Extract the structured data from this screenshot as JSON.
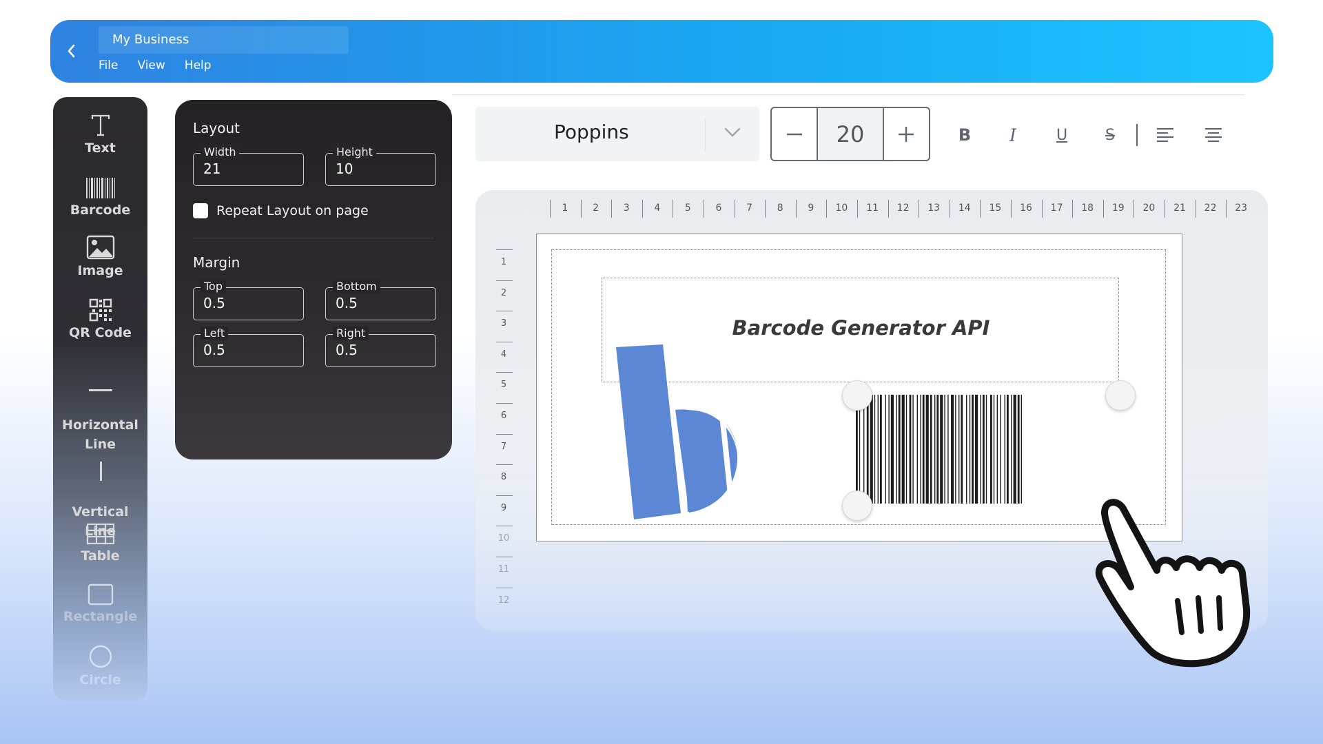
{
  "header": {
    "document_title": "My Business",
    "menu": [
      "File",
      "View",
      "Help"
    ]
  },
  "tools": [
    {
      "label": "Text",
      "icon": "text-icon"
    },
    {
      "label": "Barcode",
      "icon": "barcode-icon"
    },
    {
      "label": "Image",
      "icon": "image-icon"
    },
    {
      "label": "QR Code",
      "icon": "qr-code-icon"
    },
    {
      "label": "Horizontal\nLine",
      "icon": "horizontal-line-icon"
    },
    {
      "label": "Vertical\nLine",
      "icon": "vertical-line-icon"
    },
    {
      "label": "Table",
      "icon": "table-icon"
    },
    {
      "label": "Rectangle",
      "icon": "rectangle-icon"
    },
    {
      "label": "Circle",
      "icon": "circle-icon"
    }
  ],
  "layout_panel": {
    "layout_title": "Layout",
    "width": {
      "label": "Width",
      "value": "21"
    },
    "height": {
      "label": "Height",
      "value": "10"
    },
    "repeat_label": "Repeat Layout on page",
    "repeat_checked": false,
    "margin_title": "Margin",
    "top": {
      "label": "Top",
      "value": "0.5"
    },
    "bottom": {
      "label": "Bottom",
      "value": "0.5"
    },
    "left": {
      "label": "Left",
      "value": "0.5"
    },
    "right": {
      "label": "Right",
      "value": "0.5"
    }
  },
  "toolbar": {
    "font": "Poppins",
    "size_minus": "–",
    "font_size": "20",
    "size_plus": "+",
    "bold": "B",
    "italic": "I",
    "underline": "U",
    "strikethrough": "S"
  },
  "ruler": {
    "horizontal": [
      "1",
      "2",
      "3",
      "4",
      "5",
      "6",
      "7",
      "8",
      "9",
      "10",
      "11",
      "12",
      "13",
      "14",
      "15",
      "16",
      "17",
      "18",
      "19",
      "20",
      "21",
      "22",
      "23"
    ],
    "vertical": [
      "1",
      "2",
      "3",
      "4",
      "5",
      "6",
      "7",
      "8",
      "9",
      "10",
      "11",
      "12"
    ]
  },
  "canvas": {
    "text": "Barcode Generator API"
  },
  "colors": {
    "header_start": "#2f83e0",
    "header_end": "#1cc4ff",
    "logo_blue": "#5b87d4",
    "panel_bg": "#272527"
  }
}
